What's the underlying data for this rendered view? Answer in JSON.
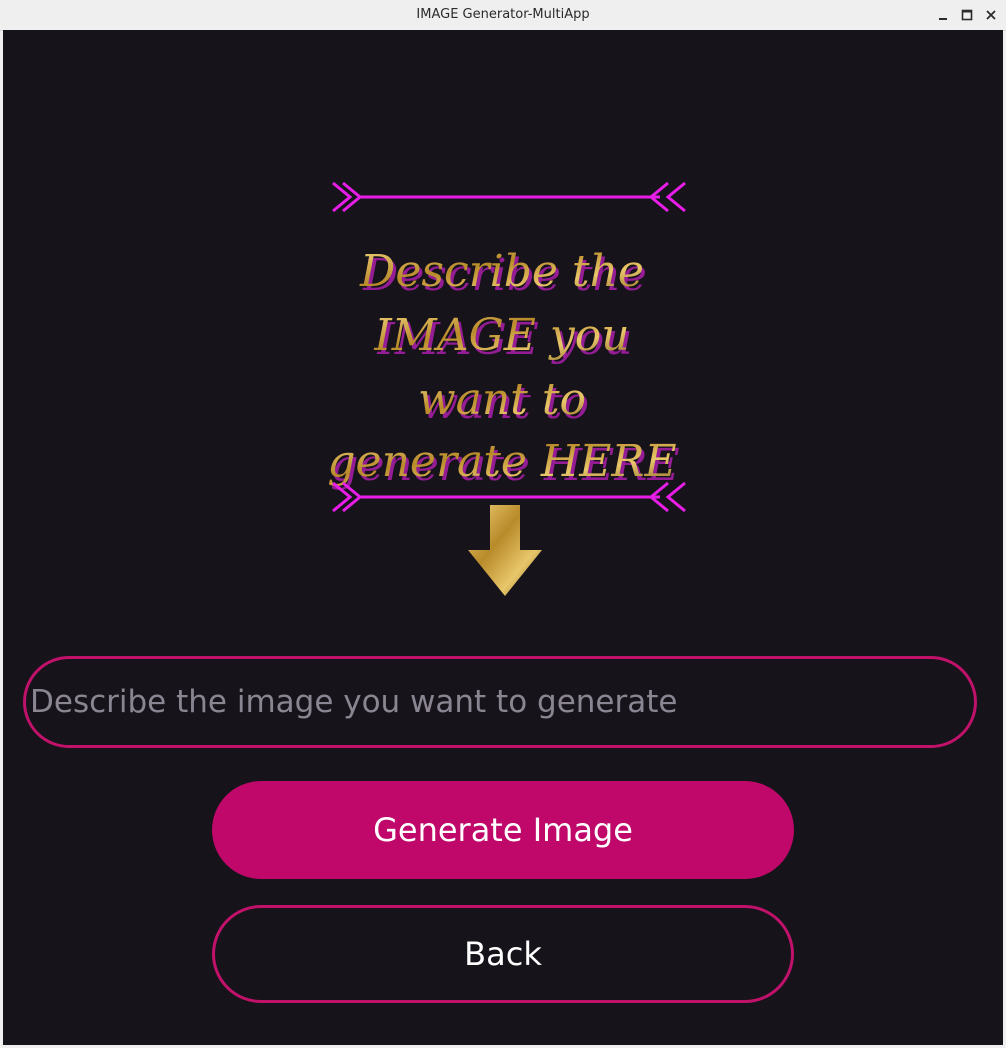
{
  "window": {
    "title": "IMAGE Generator-MultiApp",
    "controls": [
      "minimize-icon",
      "maximize-icon",
      "close-icon"
    ]
  },
  "banner": {
    "lines": [
      "Describe the",
      "IMAGE you",
      "want to",
      "generate HERE"
    ],
    "colors": {
      "arrow_accent": "#e81ee8",
      "text_gold": "#d6b24a",
      "text_shadow": "#b41fb4"
    }
  },
  "prompt": {
    "placeholder": "Describe the image you want to generate",
    "value": ""
  },
  "buttons": {
    "generate_label": "Generate Image",
    "back_label": "Back"
  },
  "theme": {
    "background": "#16131a",
    "accent": "#c0086a"
  }
}
